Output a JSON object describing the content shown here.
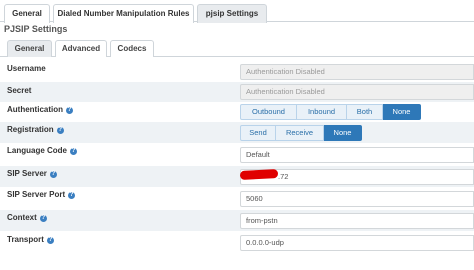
{
  "top_tabs": [
    {
      "label": "General",
      "active": false
    },
    {
      "label": "Dialed Number Manipulation Rules",
      "active": false
    },
    {
      "label": "pjsip Settings",
      "active": true
    }
  ],
  "section_title": "PJSIP Settings",
  "sub_tabs": [
    {
      "label": "General",
      "active": true
    },
    {
      "label": "Advanced",
      "active": false
    },
    {
      "label": "Codecs",
      "active": false
    }
  ],
  "fields": {
    "username": {
      "label": "Username",
      "value": "Authentication Disabled"
    },
    "secret": {
      "label": "Secret",
      "value": "Authentication Disabled"
    },
    "authentication": {
      "label": "Authentication",
      "options": [
        "Outbound",
        "Inbound",
        "Both",
        "None"
      ],
      "selected": "None"
    },
    "registration": {
      "label": "Registration",
      "options": [
        "Send",
        "Receive",
        "None"
      ],
      "selected": "None"
    },
    "language_code": {
      "label": "Language Code",
      "value": "Default"
    },
    "sip_server": {
      "label": "SIP Server",
      "value_visible": ".72"
    },
    "sip_server_port": {
      "label": "SIP Server Port",
      "value": "5060"
    },
    "context": {
      "label": "Context",
      "value": "from-pstn"
    },
    "transport": {
      "label": "Transport",
      "value": "0.0.0.0-udp"
    }
  },
  "help_icon": "question-circle-icon",
  "colors": {
    "accent": "#2e78b8",
    "help": "#3b7fc1",
    "row_shade": "#eef2f5",
    "redaction": "#e00000"
  }
}
